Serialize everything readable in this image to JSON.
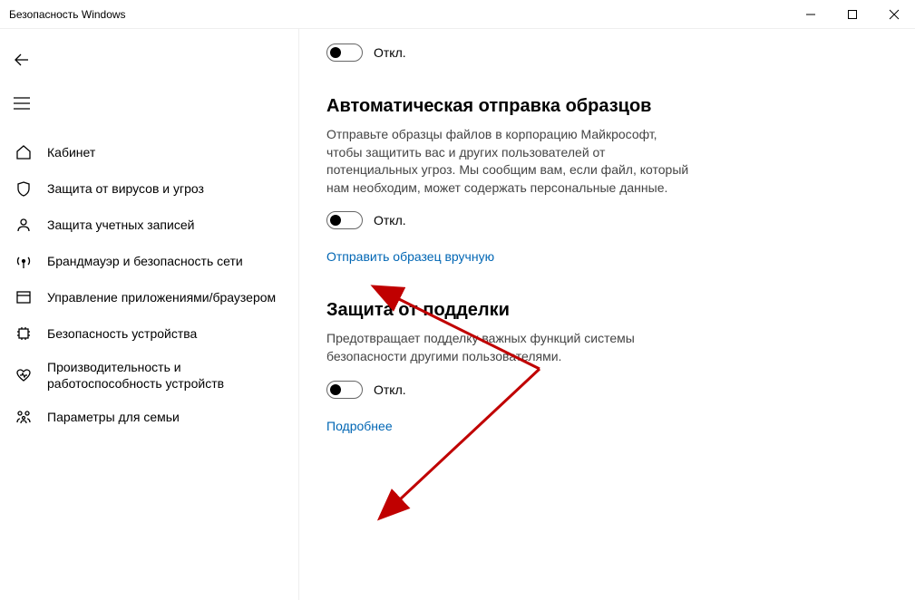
{
  "window": {
    "title": "Безопасность Windows"
  },
  "sidebar": {
    "items": [
      {
        "label": "Кабинет"
      },
      {
        "label": "Защита от вирусов и угроз"
      },
      {
        "label": "Защита учетных записей"
      },
      {
        "label": "Брандмауэр и безопасность сети"
      },
      {
        "label": "Управление приложениями/браузером"
      },
      {
        "label": "Безопасность устройства"
      },
      {
        "label": "Производительность и работоспособность устройств"
      },
      {
        "label": "Параметры для семьи"
      }
    ]
  },
  "content": {
    "toggle_off": "Откл.",
    "section1": {
      "heading": "Автоматическая отправка образцов",
      "desc": "Отправьте образцы файлов в корпорацию Майкрософт, чтобы защитить вас и других пользователей от потенциальных угроз. Мы сообщим вам, если файл, который нам необходим, может содержать персональные данные.",
      "link": "Отправить образец вручную"
    },
    "section2": {
      "heading": "Защита от подделки",
      "desc": "Предотвращает подделку важных функций системы безопасности другими пользователями.",
      "link": "Подробнее"
    }
  }
}
